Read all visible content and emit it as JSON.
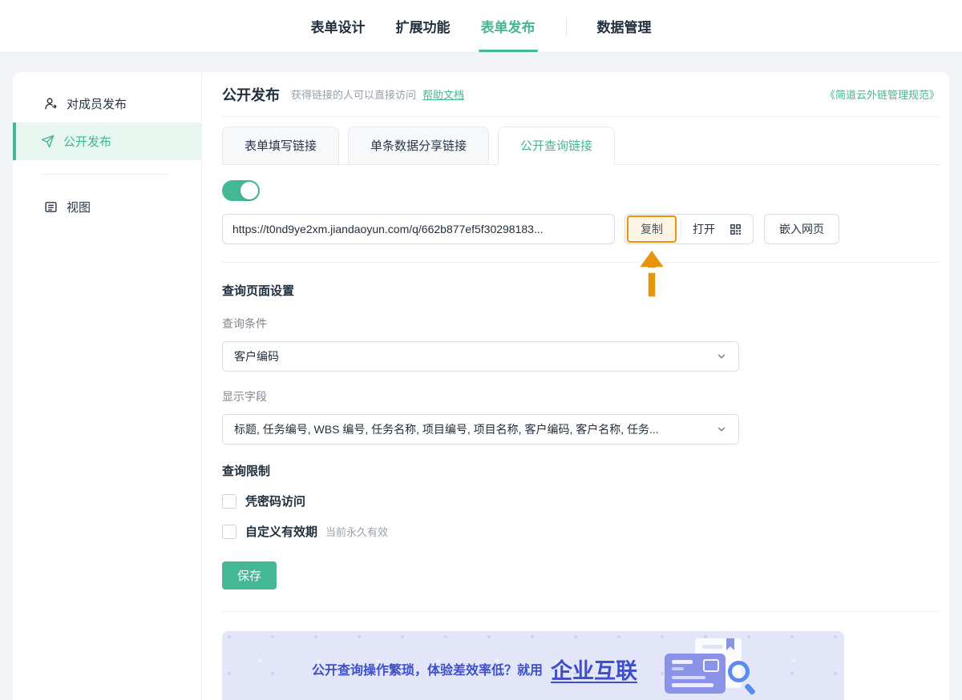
{
  "topnav": {
    "items": [
      {
        "label": "表单设计",
        "active": false
      },
      {
        "label": "扩展功能",
        "active": false
      },
      {
        "label": "表单发布",
        "active": true
      },
      {
        "label": "数据管理",
        "active": false
      }
    ]
  },
  "sidebar": {
    "items": [
      {
        "label": "对成员发布",
        "icon": "user-publish-icon",
        "active": false
      },
      {
        "label": "公开发布",
        "icon": "send-icon",
        "active": true
      },
      {
        "label": "视图",
        "icon": "view-icon",
        "active": false
      }
    ]
  },
  "header": {
    "title": "公开发布",
    "subtitle": "获得链接的人可以直接访问",
    "help_link": "帮助文档",
    "policy_link": "《简道云外链管理规范》"
  },
  "tabs": [
    {
      "label": "表单填写链接",
      "active": false
    },
    {
      "label": "单条数据分享链接",
      "active": false
    },
    {
      "label": "公开查询链接",
      "active": true
    }
  ],
  "link_panel": {
    "toggle_on": true,
    "url": "https://t0nd9ye2xm.jiandaoyun.com/q/662b877ef5f30298183...",
    "copy_label": "复制",
    "open_label": "打开",
    "qr_icon": "qr-code-icon",
    "embed_label": "嵌入网页"
  },
  "query_settings": {
    "title": "查询页面设置",
    "condition_label": "查询条件",
    "condition_value": "客户编码",
    "fields_label": "显示字段",
    "fields_value": "标题, 任务编号, WBS 编号, 任务名称, 项目编号, 项目名称, 客户编码, 客户名称, 任务..."
  },
  "query_limits": {
    "title": "查询限制",
    "password_label": "凭密码访问",
    "password_checked": false,
    "validity_label": "自定义有效期",
    "validity_checked": false,
    "validity_note": "当前永久有效"
  },
  "save_label": "保存",
  "banner": {
    "text": "公开查询操作繁琐，体验差效率低？就用",
    "brand": "企业互联"
  },
  "colors": {
    "accent_green": "#44b794",
    "highlight_orange": "#e8930c",
    "banner_bg": "#e3e6f9",
    "banner_text": "#3d50c9",
    "active_sidebar_bg": "#e8f6f0"
  }
}
